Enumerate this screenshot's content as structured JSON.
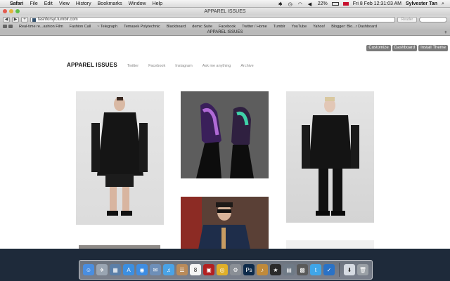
{
  "menubar": {
    "app_name": "Safari",
    "items": [
      "File",
      "Edit",
      "View",
      "History",
      "Bookmarks",
      "Window",
      "Help"
    ],
    "battery": "22%",
    "datetime": "Fri 8 Feb  12:31:03 AM",
    "user": "Sylvester Tan"
  },
  "window": {
    "title": "APPAREL ISSUES",
    "url": "fashforsyl.tumblr.com",
    "reader_label": "Reader",
    "bookmarks": [
      "Real-time re...ashion Film",
      "Fashion Call",
      "~ Telegraph",
      "Temasek Polytechnic",
      "Blackboard",
      "demic Suite",
      "Facebook",
      "Twitter / Home",
      "Tumblr",
      "YouTube",
      "Yahoo!",
      "Blogger: Blo...r Dashboard"
    ],
    "tab_title": "APPAREL ISSUES"
  },
  "tumblr_controls": {
    "customize": "Customize",
    "dashboard": "Dashboard",
    "install_theme": "Install Theme"
  },
  "blog": {
    "title": "APPAREL ISSUES",
    "nav": [
      "Twitter",
      "Facebook",
      "Instagram",
      "Ask me anything",
      "Archive"
    ]
  },
  "accent_colors": {
    "traffic_red": "#e45b50",
    "traffic_yellow": "#e3b33a",
    "traffic_green": "#5fbf4a",
    "tumblr_control_bg": "#7b7b7b"
  }
}
